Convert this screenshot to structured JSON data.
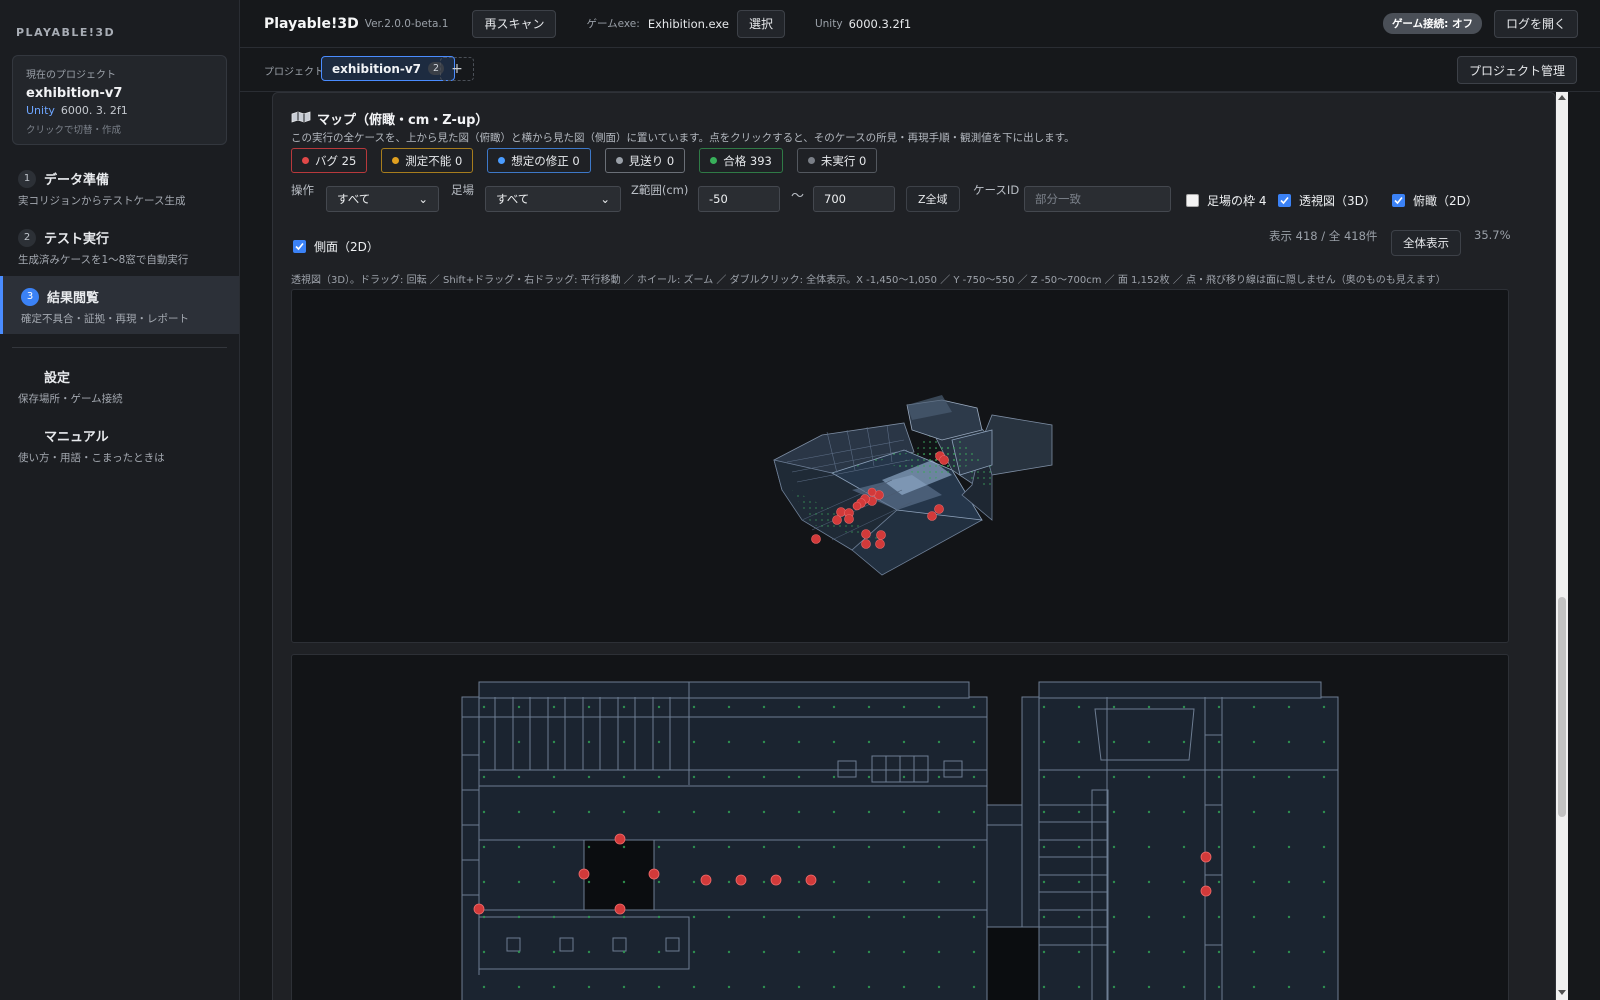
{
  "sidebar": {
    "brand": "PLAYABLE!3D",
    "project_card": {
      "label": "現在のプロジェクト",
      "name": "exhibition-v7",
      "unity_label": "Unity",
      "unity_version": "6000. 3. 2f1",
      "hint": "クリックで切替・作成"
    },
    "items": [
      {
        "num": "1",
        "label": "データ準備",
        "sub": "実コリジョンからテストケース生成"
      },
      {
        "num": "2",
        "label": "テスト実行",
        "sub": "生成済みケースを1〜8窓で自動実行"
      },
      {
        "num": "3",
        "label": "結果閲覧",
        "sub": "確定不具合・証拠・再現・レポート"
      },
      {
        "label": "設定",
        "sub": "保存場所・ゲーム接続"
      },
      {
        "label": "マニュアル",
        "sub": "使い方・用語・こまったときは"
      }
    ]
  },
  "topbar": {
    "title": "Playable!3D",
    "version": "Ver.2.0.0-beta.1",
    "rescan": "再スキャン",
    "game_exe_label": "ゲームexe:",
    "game_exe": "Exhibition.exe",
    "select": "選択",
    "unity_label": "Unity",
    "unity_version": "6000.3.2f1",
    "connection": "ゲーム接続: オフ",
    "open_log": "ログを開く"
  },
  "tabbar": {
    "label": "プロジェクト",
    "tab_name": "exhibition-v7",
    "tab_count": "2",
    "add": "+",
    "manage": "プロジェクト管理"
  },
  "map": {
    "title": "マップ（俯瞰・cm・Z-up）",
    "description": "この実行の全ケースを、上から見た図（俯瞰）と横から見た図（側面）に置いています。点をクリックすると、そのケースの所見・再現手順・観測値を下に出します。",
    "chips": [
      {
        "label": "バグ 25",
        "color": "#e04848",
        "border": "#b8393c"
      },
      {
        "label": "測定不能 0",
        "color": "#e0a020",
        "border": "#a77d1d"
      },
      {
        "label": "想定の修正 0",
        "color": "#4a9cff",
        "border": "#3d78c8"
      },
      {
        "label": "見送り 0",
        "color": "#9aa0a8",
        "border": "#6a6f77"
      },
      {
        "label": "合格 393",
        "color": "#38b05a",
        "border": "#2f7a46"
      },
      {
        "label": "未実行 0",
        "color": "#7a7f87",
        "border": "#53585f"
      }
    ],
    "filters": {
      "op_label": "操作",
      "op_value": "すべて",
      "scaffold_label": "足場",
      "scaffold_value": "すべて",
      "z_label": "Z範囲(cm)",
      "z_min": "-50",
      "tilde": "〜",
      "z_max": "700",
      "z_all": "Z全域",
      "case_id_label": "ケースID",
      "case_id_placeholder": "部分一致",
      "cb_scaffold_frame": "足場の枠 4",
      "cb_perspective": "透視図（3D）",
      "cb_topdown": "俯瞰（2D）"
    },
    "row2": {
      "cb_side": "側面（2D）",
      "display_count": "表示 418 / 全 418件",
      "show_all": "全体表示",
      "zoom": "35.7%"
    },
    "help": "透視図（3D）。ドラッグ: 回転 ／ Shift+ドラッグ・右ドラッグ: 平行移動 ／ ホイール: ズーム ／ ダブルクリック: 全体表示。X -1,450〜1,050 ／ Y -750〜550 ／ Z -50〜700cm ／ 面 1,152枚 ／ 点・飛び移り線は面に隠しません（奥のものも見えます）"
  },
  "colors": {
    "accent": "#3b82f6",
    "bug": "#e04848",
    "pass": "#38b05a",
    "panel": "#1f2125",
    "background": "#16181b"
  }
}
